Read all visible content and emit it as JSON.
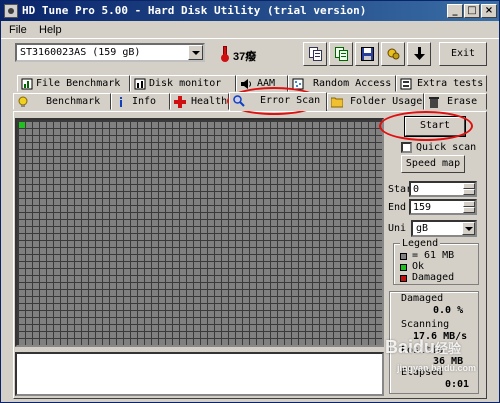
{
  "window": {
    "title": "HD Tune Pro 5.00 - Hard Disk Utility (trial version)",
    "minimize_label": "_",
    "maximize_label": "□",
    "close_label": "×"
  },
  "menu": {
    "file": "File",
    "help": "Help"
  },
  "toolbar": {
    "drive": "ST3160023AS (159 gB)",
    "temperature": "37癈",
    "exit_label": "Exit",
    "icons": [
      "copy-icon",
      "copy-all-icon",
      "save-icon",
      "options-icon",
      "download-icon"
    ]
  },
  "tabs": {
    "row1": [
      {
        "label": "File Benchmark",
        "icon": "file-benchmark-icon"
      },
      {
        "label": "Disk monitor",
        "icon": "disk-monitor-icon"
      },
      {
        "label": "AAM",
        "icon": "speaker-icon"
      },
      {
        "label": "Random Access",
        "icon": "random-access-icon"
      },
      {
        "label": "Extra tests",
        "icon": "extra-tests-icon"
      }
    ],
    "row2": [
      {
        "label": "Benchmark",
        "icon": "benchmark-icon"
      },
      {
        "label": "Info",
        "icon": "info-icon"
      },
      {
        "label": "Health",
        "icon": "health-icon"
      },
      {
        "label": "Error Scan",
        "icon": "magnifier-icon",
        "active": true
      },
      {
        "label": "Folder Usage",
        "icon": "folder-icon"
      },
      {
        "label": "Erase",
        "icon": "trash-icon"
      }
    ]
  },
  "scan": {
    "start_label": "Start",
    "quick_scan_label": "Quick scan",
    "quick_scan_checked": false,
    "speed_map_label": "Speed map",
    "start_field_label": "Star",
    "start_value": "0",
    "end_field_label": "End",
    "end_value": "159",
    "unit_label": "Uni",
    "unit_value": "gB"
  },
  "legend": {
    "title": "Legend",
    "block_size": "= 61 MB",
    "ok": "Ok",
    "damaged": "Damaged",
    "colors": {
      "unscanned": "#808080",
      "ok": "#20c020",
      "damaged": "#c01010"
    }
  },
  "stats": {
    "damaged_label": "Damaged",
    "damaged_value": "0.0 %",
    "scanning_label": "Scanning",
    "scanning_value": "17.6 MB/s",
    "position_label": "Positio",
    "position_value": "36 MB",
    "elapsed_label": "Elapsed",
    "elapsed_value": "0:01"
  },
  "grid": {
    "cells_scanned": 1
  },
  "watermark": {
    "brand": "Baidu",
    "suffix": "经验",
    "url": "jingyan.baidu.com"
  }
}
